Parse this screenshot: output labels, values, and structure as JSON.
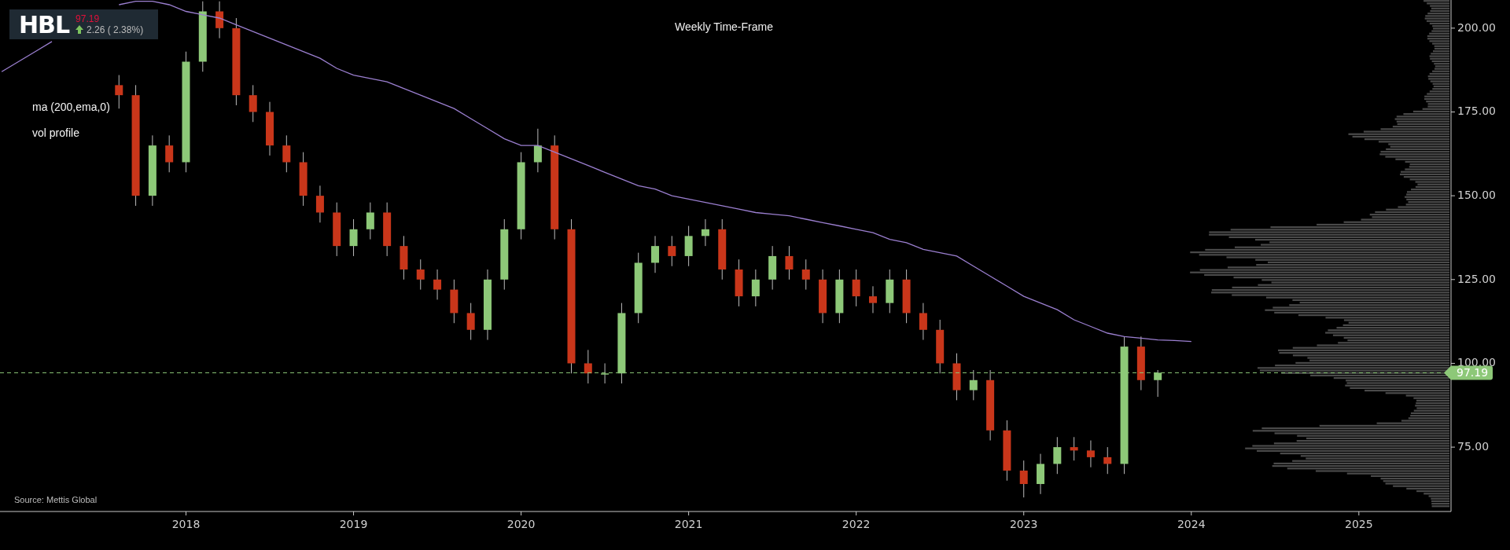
{
  "legend": {
    "symbol": "HBL",
    "price": "97.19",
    "change": "2.26 ( 2.38%)"
  },
  "title": "Weekly Time-Frame",
  "profile_label": "vol profile",
  "source": "Source: Mettis Global",
  "chart": {
    "chart_data": {
      "type": "candlestick",
      "x": [
        2016.9,
        2017.0,
        2017.1,
        2017.2,
        2017.3,
        2017.4,
        2017.5,
        2017.6,
        2017.7,
        2017.8,
        2017.9,
        2018.0,
        2018.1,
        2018.2,
        2018.3,
        2018.4,
        2018.5,
        2018.6,
        2018.7,
        2018.8,
        2018.9,
        2019.0,
        2019.1,
        2019.2,
        2019.3,
        2019.4,
        2019.5,
        2019.6,
        2019.7,
        2019.8,
        2019.9,
        2020.0,
        2020.1,
        2020.2,
        2020.3,
        2020.4,
        2020.5,
        2020.6,
        2020.7,
        2020.8,
        2020.9,
        2021.0,
        2021.1,
        2021.2,
        2021.3,
        2021.4,
        2021.5,
        2021.6,
        2021.7,
        2021.8,
        2021.9,
        2022.0,
        2022.1,
        2022.2,
        2022.3,
        2022.4,
        2022.5,
        2022.6,
        2022.7,
        2022.8,
        2022.9,
        2023.0,
        2023.1,
        2023.2,
        2023.3,
        2023.4,
        2023.5,
        2023.6,
        2023.7,
        2023.8,
        2023.9,
        2024.0
      ],
      "ohlc": [
        null,
        null,
        null,
        null,
        null,
        null,
        null,
        [
          183,
          186,
          176,
          180
        ],
        [
          180,
          183,
          147,
          150
        ],
        [
          150,
          168,
          147,
          165
        ],
        [
          165,
          168,
          157,
          160
        ],
        [
          160,
          193,
          157,
          190
        ],
        [
          190,
          208,
          187,
          205
        ],
        [
          205,
          208,
          197,
          200
        ],
        [
          200,
          203,
          177,
          180
        ],
        [
          180,
          183,
          172,
          175
        ],
        [
          175,
          178,
          162,
          165
        ],
        [
          165,
          168,
          157,
          160
        ],
        [
          160,
          163,
          147,
          150
        ],
        [
          150,
          153,
          142,
          145
        ],
        [
          145,
          148,
          132,
          135
        ],
        [
          135,
          143,
          132,
          140
        ],
        [
          140,
          148,
          137,
          145
        ],
        [
          145,
          148,
          132,
          135
        ],
        [
          135,
          138,
          125,
          128
        ],
        [
          128,
          131,
          122,
          125
        ],
        [
          125,
          128,
          119,
          122
        ],
        [
          122,
          125,
          112,
          115
        ],
        [
          115,
          118,
          107,
          110
        ],
        [
          110,
          128,
          107,
          125
        ],
        [
          125,
          143,
          122,
          140
        ],
        [
          140,
          163,
          137,
          160
        ],
        [
          160,
          170,
          157,
          165
        ],
        [
          165,
          168,
          137,
          140
        ],
        [
          140,
          143,
          97,
          100
        ],
        [
          100,
          104,
          94,
          97
        ],
        [
          97,
          100,
          94,
          97
        ],
        [
          97,
          118,
          94,
          115
        ],
        [
          115,
          133,
          112,
          130
        ],
        [
          130,
          138,
          127,
          135
        ],
        [
          135,
          138,
          129,
          132
        ],
        [
          132,
          141,
          129,
          138
        ],
        [
          138,
          143,
          135,
          140
        ],
        [
          140,
          143,
          125,
          128
        ],
        [
          128,
          131,
          117,
          120
        ],
        [
          120,
          128,
          117,
          125
        ],
        [
          125,
          135,
          122,
          132
        ],
        [
          132,
          135,
          125,
          128
        ],
        [
          128,
          131,
          122,
          125
        ],
        [
          125,
          128,
          112,
          115
        ],
        [
          115,
          128,
          112,
          125
        ],
        [
          125,
          128,
          117,
          120
        ],
        [
          120,
          123,
          115,
          118
        ],
        [
          118,
          128,
          115,
          125
        ],
        [
          125,
          128,
          112,
          115
        ],
        [
          115,
          118,
          107,
          110
        ],
        [
          110,
          113,
          97,
          100
        ],
        [
          100,
          103,
          89,
          92
        ],
        [
          92,
          98,
          89,
          95
        ],
        [
          95,
          98,
          77,
          80
        ],
        [
          80,
          83,
          65,
          68
        ],
        [
          68,
          71,
          60,
          64
        ],
        [
          64,
          73,
          61,
          70
        ],
        [
          70,
          78,
          67,
          75
        ],
        [
          75,
          78,
          71,
          74
        ],
        [
          74,
          77,
          69,
          72
        ],
        [
          72,
          75,
          67,
          70
        ],
        [
          70,
          108,
          67,
          105
        ],
        [
          105,
          108,
          92,
          95
        ],
        [
          95,
          98,
          90,
          97.2
        ],
        null,
        null
      ],
      "series": [
        {
          "name": "ma (200,ema,0)",
          "type": "line",
          "color": "#9b7fd0",
          "values": [
            187,
            190,
            193,
            196,
            null,
            null,
            null,
            207,
            208,
            208,
            207,
            205,
            204,
            203,
            201,
            199,
            197,
            195,
            193,
            191,
            188,
            186,
            185,
            184,
            182,
            180,
            178,
            176,
            173,
            170,
            167,
            165,
            165,
            163,
            161,
            159,
            157,
            155,
            153,
            152,
            150,
            149,
            148,
            147,
            146,
            145,
            144.5,
            144,
            143,
            142,
            141,
            140,
            139,
            137,
            136,
            134,
            133,
            132,
            129,
            126,
            123,
            120,
            118,
            116,
            113,
            111,
            109,
            108,
            107.5,
            107,
            106.8,
            106.5
          ]
        }
      ],
      "xlim": [
        2016.89,
        2025.55
      ],
      "ylim": [
        55.8,
        208.4
      ],
      "xticks": [
        {
          "value": 2018,
          "label": "2018"
        },
        {
          "value": 2019,
          "label": "2019"
        },
        {
          "value": 2020,
          "label": "2020"
        },
        {
          "value": 2021,
          "label": "2021"
        },
        {
          "value": 2022,
          "label": "2022"
        },
        {
          "value": 2023,
          "label": "2023"
        },
        {
          "value": 2024,
          "label": "2024"
        },
        {
          "value": 2025,
          "label": "2025"
        }
      ],
      "yticks": [
        {
          "value": 75,
          "label": "75.00"
        },
        {
          "value": 100,
          "label": "100.00"
        },
        {
          "value": 125,
          "label": "125.00"
        },
        {
          "value": 150,
          "label": "150.00"
        },
        {
          "value": 175,
          "label": "175.00"
        },
        {
          "value": 200,
          "label": "200.00"
        }
      ],
      "ref_lines": [
        {
          "axis": "y",
          "value": 97.19,
          "label": "97.19",
          "color": "#8dc878"
        }
      ]
    }
  }
}
